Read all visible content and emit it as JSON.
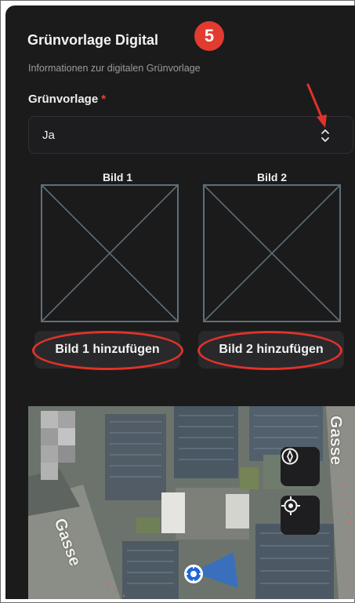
{
  "header": {
    "title": "Grünvorlage Digital",
    "step_badge": "5",
    "subtitle": "Informationen zur digitalen Grünvorlage"
  },
  "field": {
    "label": "Grünvorlage",
    "required_marker": "*",
    "selected_value": "Ja"
  },
  "images": [
    {
      "label": "Bild 1",
      "button": "Bild 1 hinzufügen"
    },
    {
      "label": "Bild 2",
      "button": "Bild 2 hinzufügen"
    }
  ],
  "map": {
    "street_labels": [
      "Gasse",
      "Gasse"
    ],
    "controls": [
      "compass-icon",
      "locate-icon"
    ],
    "location_marker": "location-marker-icon"
  },
  "colors": {
    "panel_bg": "#1b1b1c",
    "accent_red": "#e23b30",
    "button_bg": "#29292b",
    "placeholder_stroke": "#5f6f78"
  }
}
